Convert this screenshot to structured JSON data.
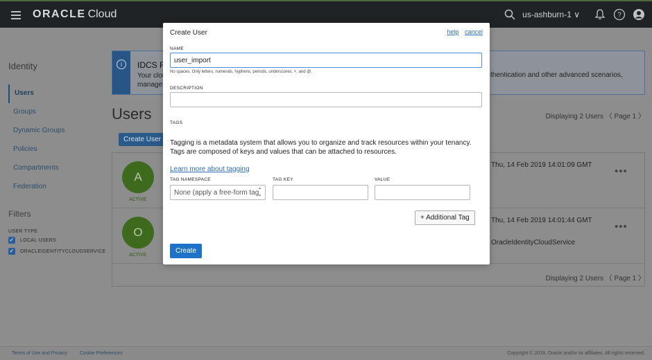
{
  "topbar": {
    "brand_primary": "ORACLE",
    "brand_secondary": "Cloud",
    "region": "us-ashburn-1 ∨"
  },
  "sidenav": {
    "title": "Identity",
    "items": [
      {
        "label": "Users",
        "active": true
      },
      {
        "label": "Groups"
      },
      {
        "label": "Dynamic Groups"
      },
      {
        "label": "Policies"
      },
      {
        "label": "Compartments"
      },
      {
        "label": "Federation"
      }
    ],
    "filters_title": "Filters",
    "user_type_label": "USER TYPE",
    "checkboxes": [
      {
        "label": "LOCAL USERS",
        "checked": true
      },
      {
        "label": "ORACLEIDENTITYCLOUDSERVICE",
        "checked": true
      }
    ]
  },
  "banner": {
    "title": "IDCS Fe",
    "line1": "Your clou",
    "line2": "manage",
    "right_text": "thentication and other advanced scenarios,"
  },
  "main": {
    "heading": "Users",
    "displaying_top": "Displaying 2 Users 〈 Page 1 〉",
    "create_button": "Create User",
    "rows": [
      {
        "initial": "A",
        "status": "ACTIVE",
        "date": "Thu, 14 Feb 2019 14:01:09 GMT",
        "idp": ""
      },
      {
        "initial": "O",
        "status": "ACTIVE",
        "date": "Thu, 14 Feb 2019 14:01:44 GMT",
        "idp": "OracleIdentityCloudService"
      }
    ],
    "displaying_bottom": "Displaying 2 Users 〈 Page 1 〉",
    "row_actions": "•••"
  },
  "footer": {
    "terms": "Terms of Use and Privacy",
    "cookie": "Cookie Preferences",
    "copyright": "Copyright © 2019, Oracle and/or its affiliates. All rights reserved."
  },
  "modal": {
    "title": "Create User",
    "help": "help",
    "cancel": "cancel",
    "name_label": "NAME",
    "name_value": "user_import",
    "name_hint": "No spaces. Only letters, numerals, hyphens, periods, underscores, +, and @.",
    "description_label": "DESCRIPTION",
    "description_value": "",
    "tags_label": "TAGS",
    "tags_description": "Tagging is a metadata system that allows you to organize and track resources within your tenancy. Tags are composed of keys and values that can be attached to resources.",
    "learn_more": "Learn more about tagging",
    "tag_namespace_label": "TAG NAMESPACE",
    "tag_namespace_value": "None (apply a free-form tag",
    "tag_key_label": "TAG KEY",
    "value_label": "VALUE",
    "additional_tag": "+ Additional Tag",
    "create_button": "Create"
  },
  "colors": {
    "topbar": "#1f2326",
    "primary_button": "#1e73c8",
    "link": "#2f6bb6",
    "avatar": "#3d6a1d"
  }
}
